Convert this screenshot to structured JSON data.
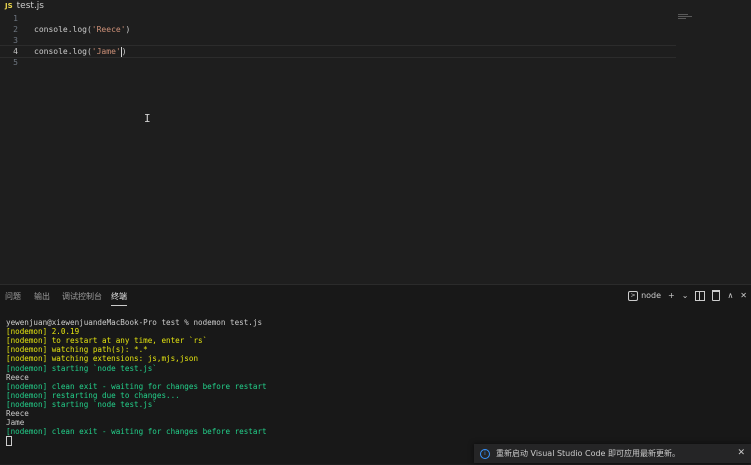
{
  "editor": {
    "file_badge": "JS",
    "file_name": "test.js",
    "lines": [
      {
        "num": "1",
        "text": ""
      },
      {
        "num": "2",
        "text": "console.log('Reece')"
      },
      {
        "num": "3",
        "text": ""
      },
      {
        "num": "4",
        "text": "console.log('Jame')"
      },
      {
        "num": "5",
        "text": ""
      }
    ],
    "line2": {
      "prefix": "console.log(",
      "string": "'Reece'",
      "suffix": ")"
    },
    "line4": {
      "prefix": "console.log(",
      "string": "'Jame'",
      "suffix": ")"
    },
    "current_line": "4"
  },
  "panel": {
    "tabs": [
      "问题",
      "输出",
      "调试控制台",
      "终端"
    ],
    "active_tab": "终端",
    "terminal_name": "node",
    "plus_icon": "+",
    "chevron_icon": "⌄",
    "close_icon": "✕",
    "maximize_icon": "∧"
  },
  "terminal": {
    "lines": [
      {
        "text": "yewenjuan@xiewenjuandeMacBook-Pro test % nodemon test.js",
        "color": "white"
      },
      {
        "text": "[nodemon] 2.0.19",
        "color": "yellow"
      },
      {
        "text": "[nodemon] to restart at any time, enter `rs`",
        "color": "yellow"
      },
      {
        "text": "[nodemon] watching path(s): *.*",
        "color": "yellow"
      },
      {
        "text": "[nodemon] watching extensions: js,mjs,json",
        "color": "yellow"
      },
      {
        "text": "[nodemon] starting `node test.js`",
        "color": "green"
      },
      {
        "text": "Reece",
        "color": "white"
      },
      {
        "text": "[nodemon] clean exit - waiting for changes before restart",
        "color": "green"
      },
      {
        "text": "[nodemon] restarting due to changes...",
        "color": "green"
      },
      {
        "text": "[nodemon] starting `node test.js`",
        "color": "green"
      },
      {
        "text": "Reece",
        "color": "white"
      },
      {
        "text": "Jame",
        "color": "white"
      },
      {
        "text": "[nodemon] clean exit - waiting for changes before restart",
        "color": "green"
      }
    ]
  },
  "notification": {
    "text": "重新启动 Visual Studio Code 即可应用最新更新。",
    "icon": "info-icon",
    "close": "✕"
  },
  "colors": {
    "yellow": "#e5e510",
    "green": "#23d18b",
    "string": "#ce9178",
    "js_badge": "#e8d44d"
  }
}
